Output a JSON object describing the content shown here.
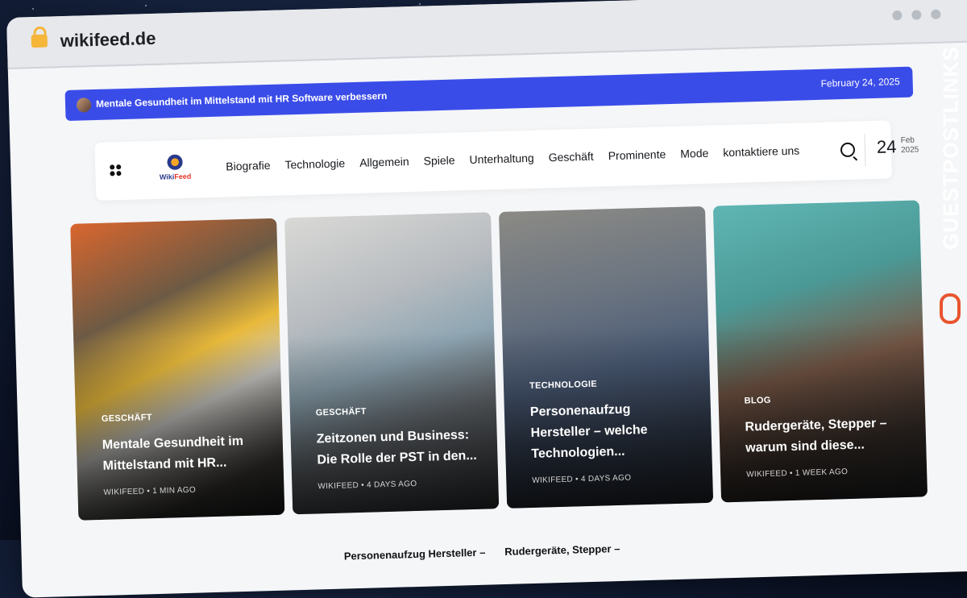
{
  "browser": {
    "url": "wikifeed.de"
  },
  "ticker": {
    "headline": "Mentale Gesundheit im Mittelstand mit HR Software verbessern",
    "date": "February 24, 2025"
  },
  "logo": {
    "text_prefix": "Wiki",
    "text_suffix": "Feed"
  },
  "nav": {
    "items": [
      {
        "label": "Biografie"
      },
      {
        "label": "Technologie"
      },
      {
        "label": "Allgemein"
      },
      {
        "label": "Spiele"
      },
      {
        "label": "Unterhaltung"
      },
      {
        "label": "Geschäft"
      },
      {
        "label": "Prominente"
      },
      {
        "label": "Mode"
      },
      {
        "label": "kontaktiere uns"
      }
    ],
    "date_day": "24",
    "date_month": "Feb",
    "date_year": "2025"
  },
  "cards": [
    {
      "category": "GESCHÄFT",
      "title": "Mentale Gesundheit im Mittelstand mit HR...",
      "meta": "WIKIFEED • 1 MIN AGO"
    },
    {
      "category": "GESCHÄFT",
      "title": "Zeitzonen und Business: Die Rolle der PST in den...",
      "meta": "WIKIFEED • 4 DAYS AGO"
    },
    {
      "category": "TECHNOLOGIE",
      "title": "Personenaufzug Hersteller – welche Technologien...",
      "meta": "WIKIFEED • 4 DAYS AGO"
    },
    {
      "category": "BLOG",
      "title": "Rudergeräte, Stepper – warum sind diese...",
      "meta": "WIKIFEED • 1 WEEK AGO"
    }
  ],
  "bottom_list": [
    {
      "title": "Personenaufzug Hersteller –"
    },
    {
      "title": "Rudergeräte, Stepper –"
    }
  ],
  "branding": {
    "text": "GUESTPOSTLINKS"
  },
  "colors": {
    "accent": "#3a4ce8",
    "brand_orange": "#e8552e"
  }
}
